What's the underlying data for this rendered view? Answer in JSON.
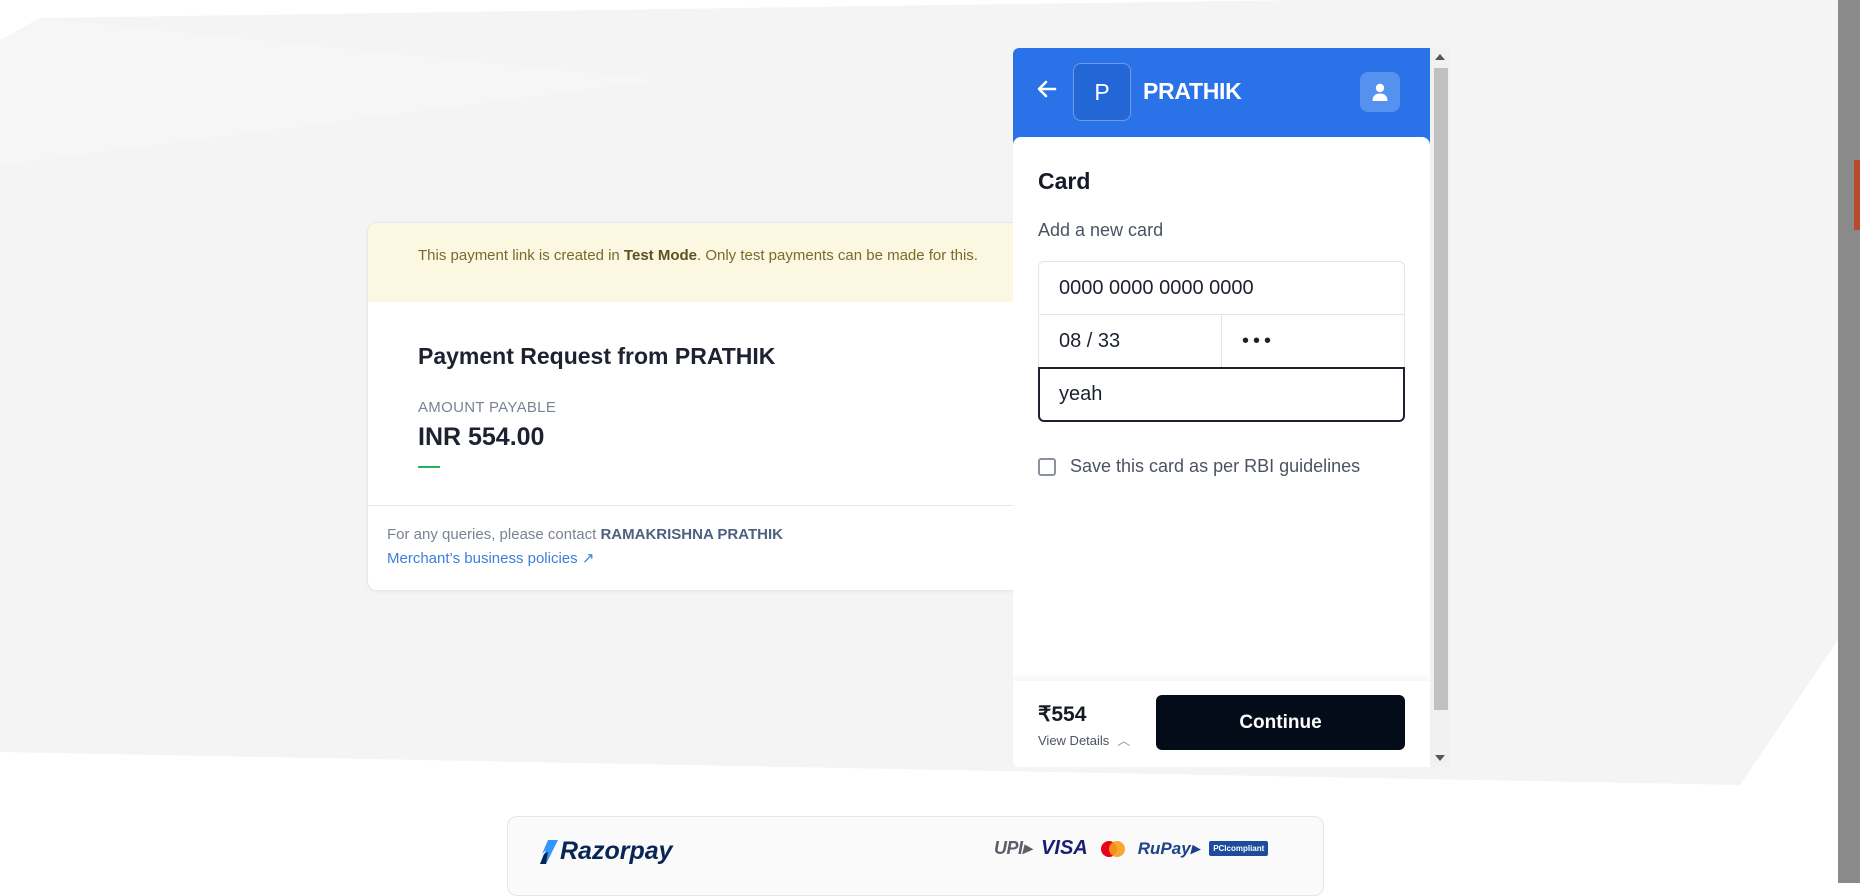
{
  "test_banner": {
    "prefix": "This payment link is created in ",
    "mode": "Test Mode",
    "suffix": ". Only test payments can be made for this."
  },
  "payment_request": {
    "title": "Payment Request from PRATHIK",
    "amount_label": "AMOUNT PAYABLE",
    "amount_value": "INR 554.00",
    "queries_prefix": "For any queries, please contact ",
    "contact_name": "RAMAKRISHNA PRATHIK",
    "policies_link": "Merchant’s business policies ↗"
  },
  "checkout": {
    "merchant_initial": "P",
    "merchant_name": "PRATHIK",
    "section_title": "Card",
    "subtitle": "Add a new card",
    "card_number": "0000 0000 0000 0000",
    "expiry": "08 / 33",
    "cvv": "•••",
    "cardholder_name": "yeah",
    "save_card_label": "Save this card as per RBI guidelines",
    "footer_amount": "₹554",
    "view_details": "View Details",
    "continue_label": "Continue",
    "accent_color": "#2a72e8"
  },
  "footer": {
    "brand": "Razorpay",
    "methods": [
      "UPI",
      "VISA",
      "Mastercard",
      "RuPay",
      "PCI compliant"
    ],
    "upi_label": "UPI▸",
    "visa_label": "VISA",
    "rupay_label": "RuPay▸",
    "pci_label": "PCIcompliant"
  }
}
